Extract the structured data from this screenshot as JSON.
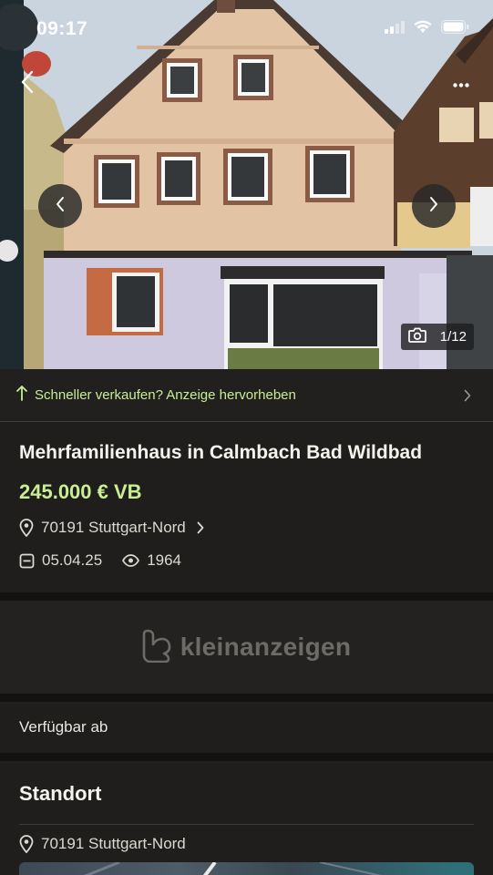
{
  "status_bar": {
    "time": "09:17"
  },
  "gallery": {
    "counter": "1/12"
  },
  "promo": {
    "label": "Schneller verkaufen? Anzeige hervorheben"
  },
  "listing": {
    "title": "Mehrfamilienhaus in Calmbach Bad Wildbad",
    "price": "245.000 € VB",
    "location": "70191 Stuttgart-Nord",
    "date": "05.04.25",
    "views": "1964"
  },
  "ad_banner": {
    "brand": "kleinanzeigen"
  },
  "details": {
    "available_label": "Verfügbar ab"
  },
  "standort": {
    "heading": "Standort",
    "location": "70191 Stuttgart-Nord"
  },
  "colors": {
    "accent": "#c9ee93",
    "background": "#1f1e1c",
    "separator": "#121211"
  },
  "icons": [
    "back-icon",
    "more-icon",
    "prev-image-icon",
    "next-image-icon",
    "camera-icon",
    "arrow-up-icon",
    "chevron-right-icon",
    "location-pin-icon",
    "calendar-icon",
    "eye-icon",
    "kleinanzeigen-logo-icon",
    "signal-icon",
    "wifi-icon",
    "battery-icon"
  ]
}
